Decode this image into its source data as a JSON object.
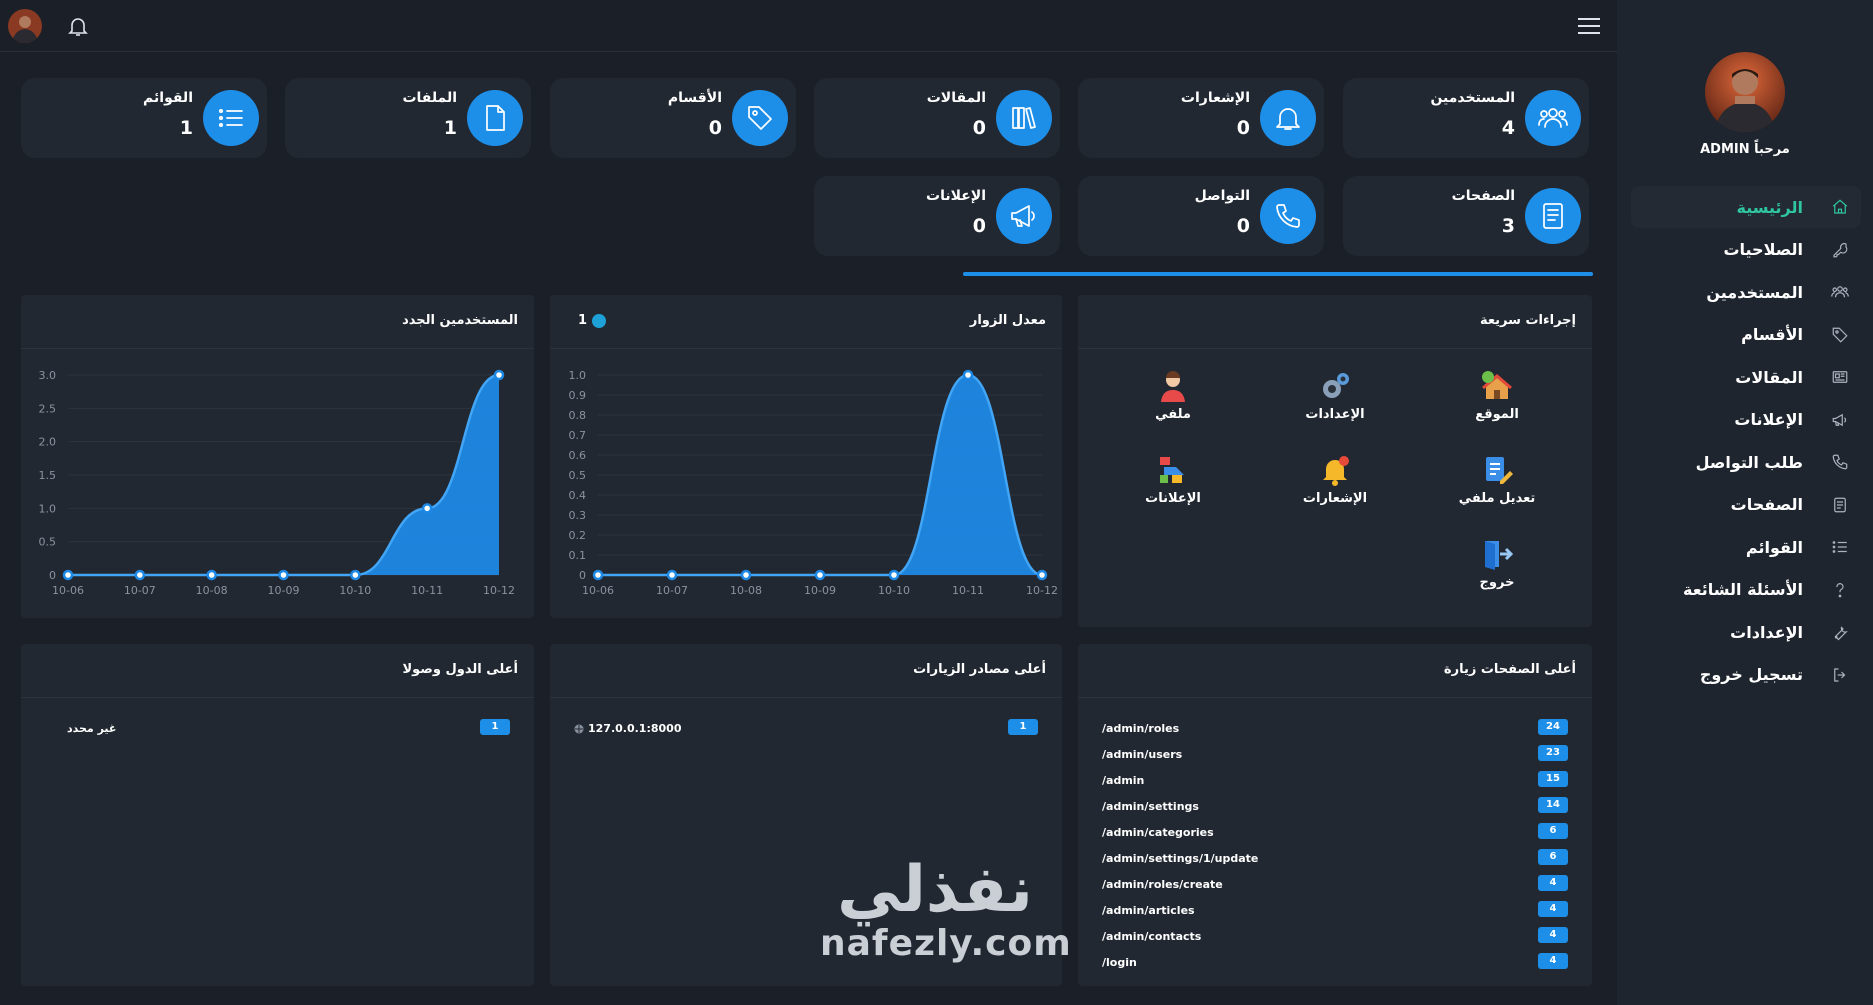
{
  "sidebar": {
    "welcome": "مرحباً ADMIN",
    "items": [
      {
        "label": "الرئيسية",
        "icon": "home-icon",
        "active": true
      },
      {
        "label": "الصلاحيات",
        "icon": "key-icon"
      },
      {
        "label": "المستخدمين",
        "icon": "users-icon"
      },
      {
        "label": "الأقسام",
        "icon": "tag-icon"
      },
      {
        "label": "المقالات",
        "icon": "newspaper-icon"
      },
      {
        "label": "الإعلانات",
        "icon": "megaphone-icon"
      },
      {
        "label": "طلب التواصل",
        "icon": "phone-icon"
      },
      {
        "label": "الصفحات",
        "icon": "page-icon"
      },
      {
        "label": "القوائم",
        "icon": "list-icon"
      },
      {
        "label": "الأسئلة الشائعة",
        "icon": "question-icon"
      },
      {
        "label": "الإعدادات",
        "icon": "wrench-icon"
      },
      {
        "label": "تسجيل خروج",
        "icon": "logout-icon"
      }
    ]
  },
  "stats": [
    {
      "title": "المستخدمين",
      "count": "4",
      "icon": "users-icon"
    },
    {
      "title": "الإشعارات",
      "count": "0",
      "icon": "bell-icon"
    },
    {
      "title": "المقالات",
      "count": "0",
      "icon": "books-icon"
    },
    {
      "title": "الأقسام",
      "count": "0",
      "icon": "tag-icon"
    },
    {
      "title": "الملفات",
      "count": "1",
      "icon": "file-icon"
    },
    {
      "title": "القوائم",
      "count": "1",
      "icon": "list-icon"
    },
    {
      "title": "الصفحات",
      "count": "3",
      "icon": "page-icon"
    },
    {
      "title": "التواصل",
      "count": "0",
      "icon": "phone-icon"
    },
    {
      "title": "الإعلانات",
      "count": "0",
      "icon": "megaphone-icon"
    }
  ],
  "quick_actions": {
    "title": "إجراءات سريعة",
    "items": [
      {
        "label": "الموقع",
        "icon": "website-icon"
      },
      {
        "label": "الإعدادات",
        "icon": "settings-gears-icon"
      },
      {
        "label": "ملفي",
        "icon": "profile-icon"
      },
      {
        "label": "تعديل ملفي",
        "icon": "edit-profile-icon"
      },
      {
        "label": "الإشعارات",
        "icon": "notification-bell-icon"
      },
      {
        "label": "الإعلانات",
        "icon": "ads-icon"
      },
      {
        "label": "خروج",
        "icon": "exit-door-icon"
      }
    ]
  },
  "visits_panel": {
    "title": "معدل الزوار",
    "legend_value": "1",
    "legend_color": "#1da1d6"
  },
  "users_panel": {
    "title": "المستخدمين الجدد"
  },
  "top_pages": {
    "title": "أعلى الصفحات زيارة",
    "rows": [
      {
        "path": "/admin/roles",
        "count": "24"
      },
      {
        "path": "/admin/users",
        "count": "23"
      },
      {
        "path": "/admin",
        "count": "15"
      },
      {
        "path": "/admin/settings",
        "count": "14"
      },
      {
        "path": "/admin/categories",
        "count": "6"
      },
      {
        "path": "/admin/settings/1/update",
        "count": "6"
      },
      {
        "path": "/admin/roles/create",
        "count": "4"
      },
      {
        "path": "/admin/articles",
        "count": "4"
      },
      {
        "path": "/admin/contacts",
        "count": "4"
      },
      {
        "path": "/login",
        "count": "4"
      }
    ]
  },
  "top_sources": {
    "title": "أعلى مصادر الزيارات",
    "rows": [
      {
        "source": "127.0.0.1:8000",
        "count": "1"
      }
    ]
  },
  "top_countries": {
    "title": "أعلى الدول وصولا",
    "rows": [
      {
        "country": "غير محدد",
        "count": "1"
      }
    ]
  },
  "watermark": {
    "arabic": "نفذلي",
    "latin": "nafezly.com"
  },
  "colors": {
    "accent": "#1e8fe8",
    "active_nav": "#2fc5a0",
    "background": "#1b2028",
    "card": "#222831"
  },
  "chart_data": [
    {
      "type": "area",
      "title": "معدل الزوار",
      "x": [
        "10-06",
        "10-07",
        "10-08",
        "10-09",
        "10-10",
        "10-11",
        "10-12"
      ],
      "series": [
        {
          "values": [
            0,
            0,
            0,
            0,
            0,
            1,
            0
          ]
        }
      ],
      "yticks": [
        "0",
        "0.1",
        "0.2",
        "0.3",
        "0.4",
        "0.5",
        "0.6",
        "0.7",
        "0.8",
        "0.9",
        "1.0"
      ],
      "ylim": [
        0,
        1
      ],
      "grid": true,
      "legend": "top-left"
    },
    {
      "type": "area",
      "title": "المستخدمين الجدد",
      "x": [
        "10-06",
        "10-07",
        "10-08",
        "10-09",
        "10-10",
        "10-11",
        "10-12"
      ],
      "series": [
        {
          "values": [
            0,
            0,
            0,
            0,
            0,
            1,
            3
          ]
        }
      ],
      "yticks": [
        "0",
        "0.5",
        "1.0",
        "1.5",
        "2.0",
        "2.5",
        "3.0"
      ],
      "ylim": [
        0,
        3
      ],
      "grid": true
    }
  ]
}
